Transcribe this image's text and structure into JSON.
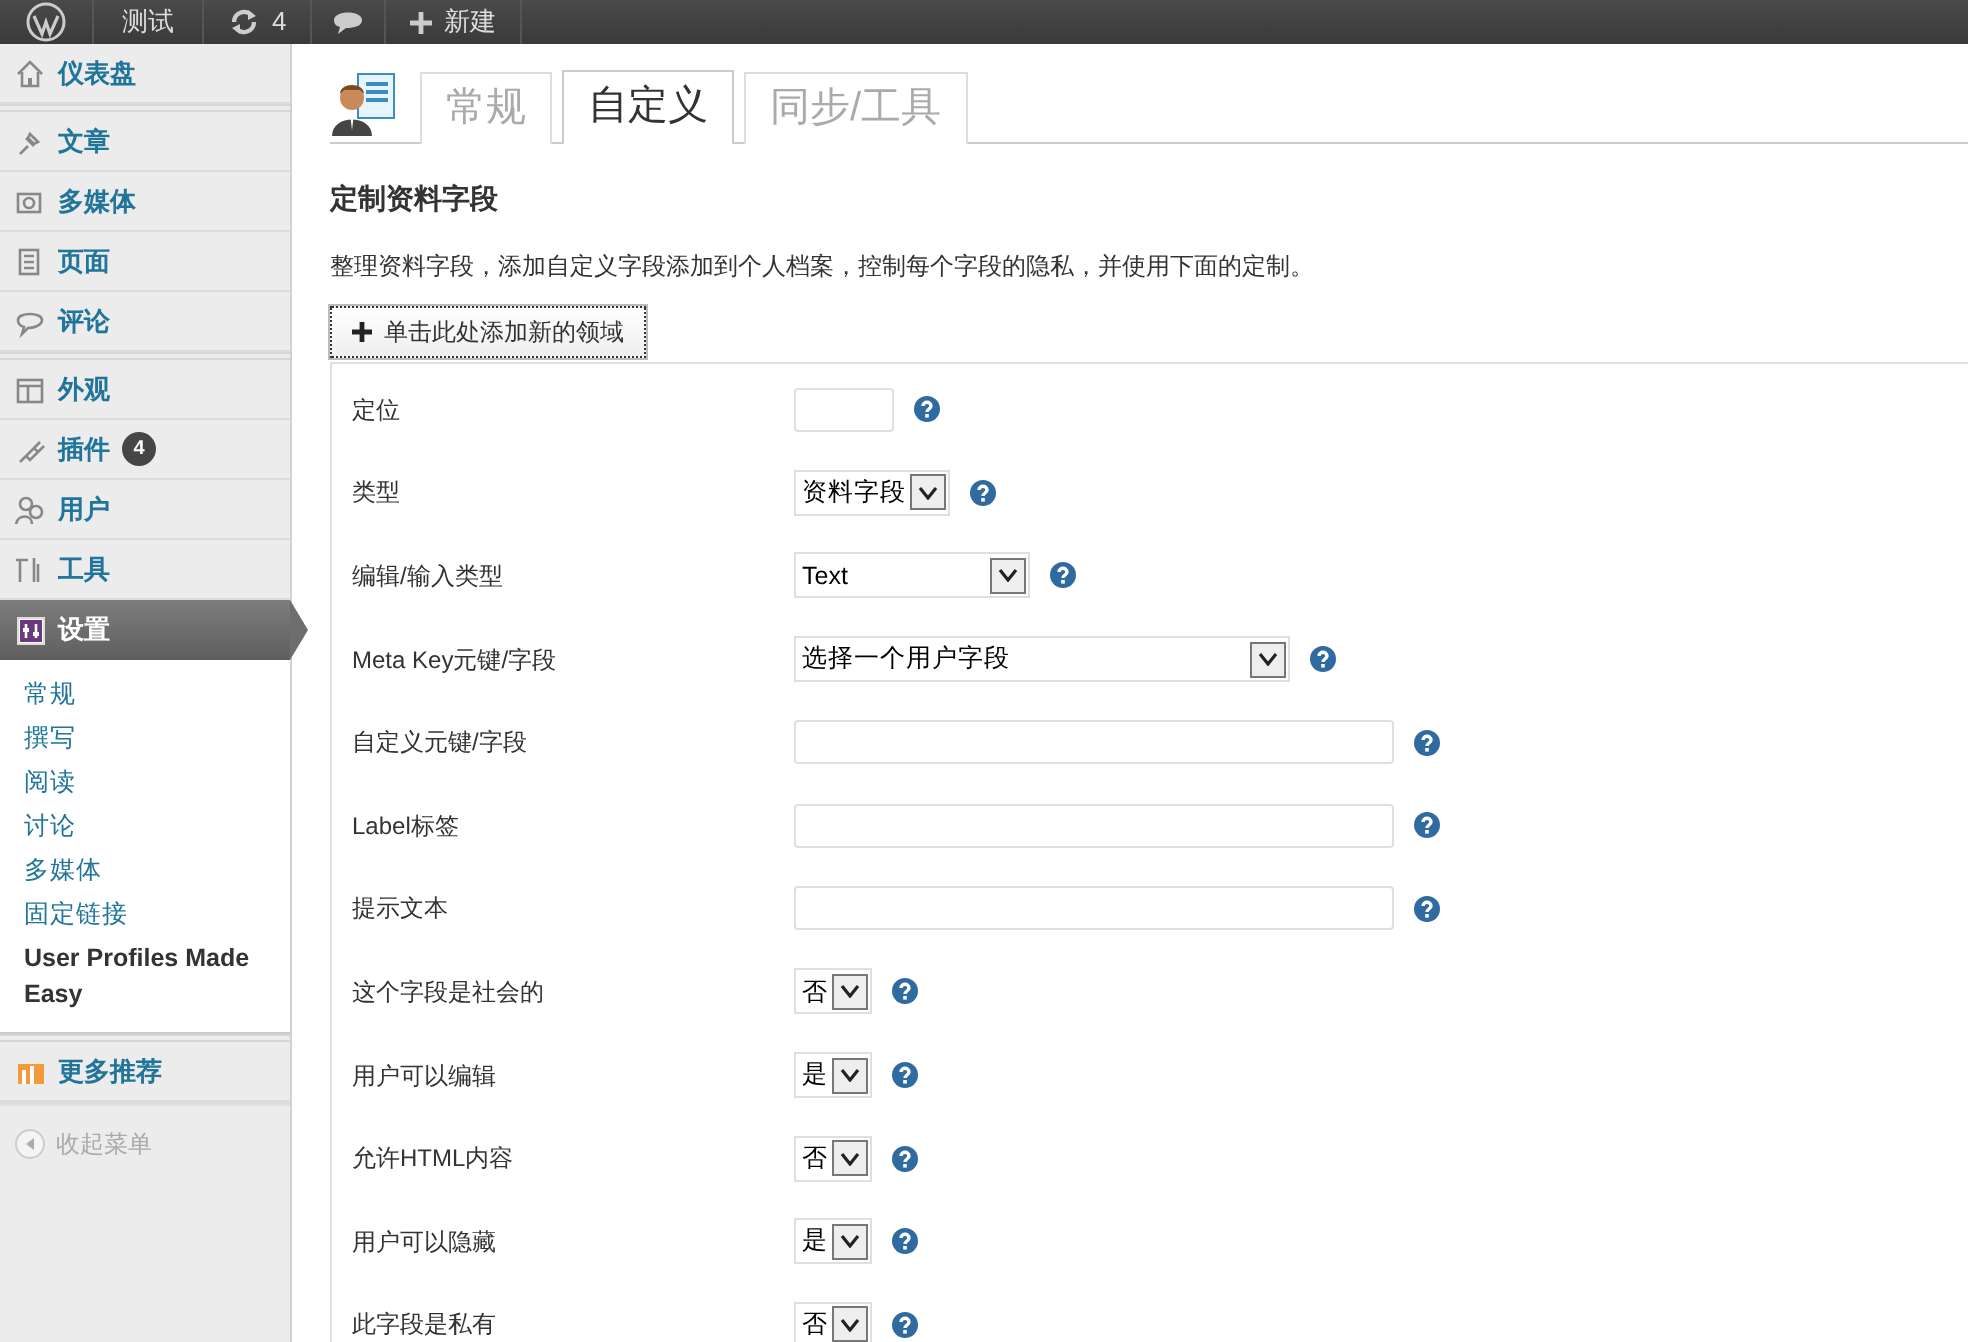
{
  "admin_bar": {
    "items": [
      {
        "kind": "logo"
      },
      {
        "kind": "site",
        "label": "测试"
      },
      {
        "kind": "updates",
        "label": "4"
      },
      {
        "kind": "comments"
      },
      {
        "kind": "new",
        "label": "新建"
      }
    ]
  },
  "sidebar": {
    "groups": [
      {
        "items": [
          {
            "kind": "dashboard",
            "label": "仪表盘",
            "selected": false
          }
        ]
      },
      {
        "items": [
          {
            "kind": "posts",
            "label": "文章",
            "selected": false
          },
          {
            "kind": "media",
            "label": "多媒体",
            "selected": false
          },
          {
            "kind": "pages",
            "label": "页面",
            "selected": false
          },
          {
            "kind": "comments",
            "label": "评论",
            "selected": false
          }
        ]
      },
      {
        "items": [
          {
            "kind": "appearance",
            "label": "外观",
            "selected": false
          },
          {
            "kind": "plugins",
            "label": "插件",
            "badge": "4",
            "selected": false
          },
          {
            "kind": "users",
            "label": "用户",
            "selected": false
          },
          {
            "kind": "tools",
            "label": "工具",
            "selected": false
          },
          {
            "kind": "settings",
            "label": "设置",
            "selected": true,
            "children": [
              {
                "label": "常规",
                "selected": false
              },
              {
                "label": "撰写",
                "selected": false
              },
              {
                "label": "阅读",
                "selected": false
              },
              {
                "label": "讨论",
                "selected": false
              },
              {
                "label": "多媒体",
                "selected": false
              },
              {
                "label": "固定链接",
                "selected": false
              },
              {
                "label": "User Profiles Made Easy",
                "selected": true
              }
            ]
          }
        ]
      },
      {
        "items": [
          {
            "kind": "more",
            "label": "更多推荐",
            "selected": false
          }
        ]
      }
    ],
    "collapse": {
      "label": "收起菜单"
    }
  },
  "tabs": [
    {
      "label": "常规",
      "selected": false
    },
    {
      "label": "自定义",
      "selected": true
    },
    {
      "label": "同步/工具",
      "selected": false
    }
  ],
  "section": {
    "title": "定制资料字段",
    "description": "整理资料字段，添加自定义字段添加到个人档案，控制每个字段的隐私，并使用下面的定制。",
    "add_button": "单击此处添加新的领域"
  },
  "fields": [
    {
      "label": "定位",
      "kind": "text"
    },
    {
      "label": "类型",
      "kind": "select",
      "value": "资料字段"
    },
    {
      "label": "编辑/输入类型",
      "kind": "select",
      "value": "Text"
    },
    {
      "label": "Meta Key元键/字段",
      "kind": "select",
      "value": "选择一个用户字段"
    },
    {
      "label": "自定义元键/字段",
      "kind": "text"
    },
    {
      "label": "Label标签",
      "kind": "text"
    },
    {
      "label": "提示文本",
      "kind": "text"
    },
    {
      "label": "这个字段是社会的",
      "kind": "select",
      "value": "否"
    },
    {
      "label": "用户可以编辑",
      "kind": "select",
      "value": "是"
    },
    {
      "label": "允许HTML内容",
      "kind": "select",
      "value": "否"
    },
    {
      "label": "用户可以隐藏",
      "kind": "select",
      "value": "是"
    },
    {
      "label": "此字段是私有",
      "kind": "select",
      "value": "否"
    }
  ]
}
